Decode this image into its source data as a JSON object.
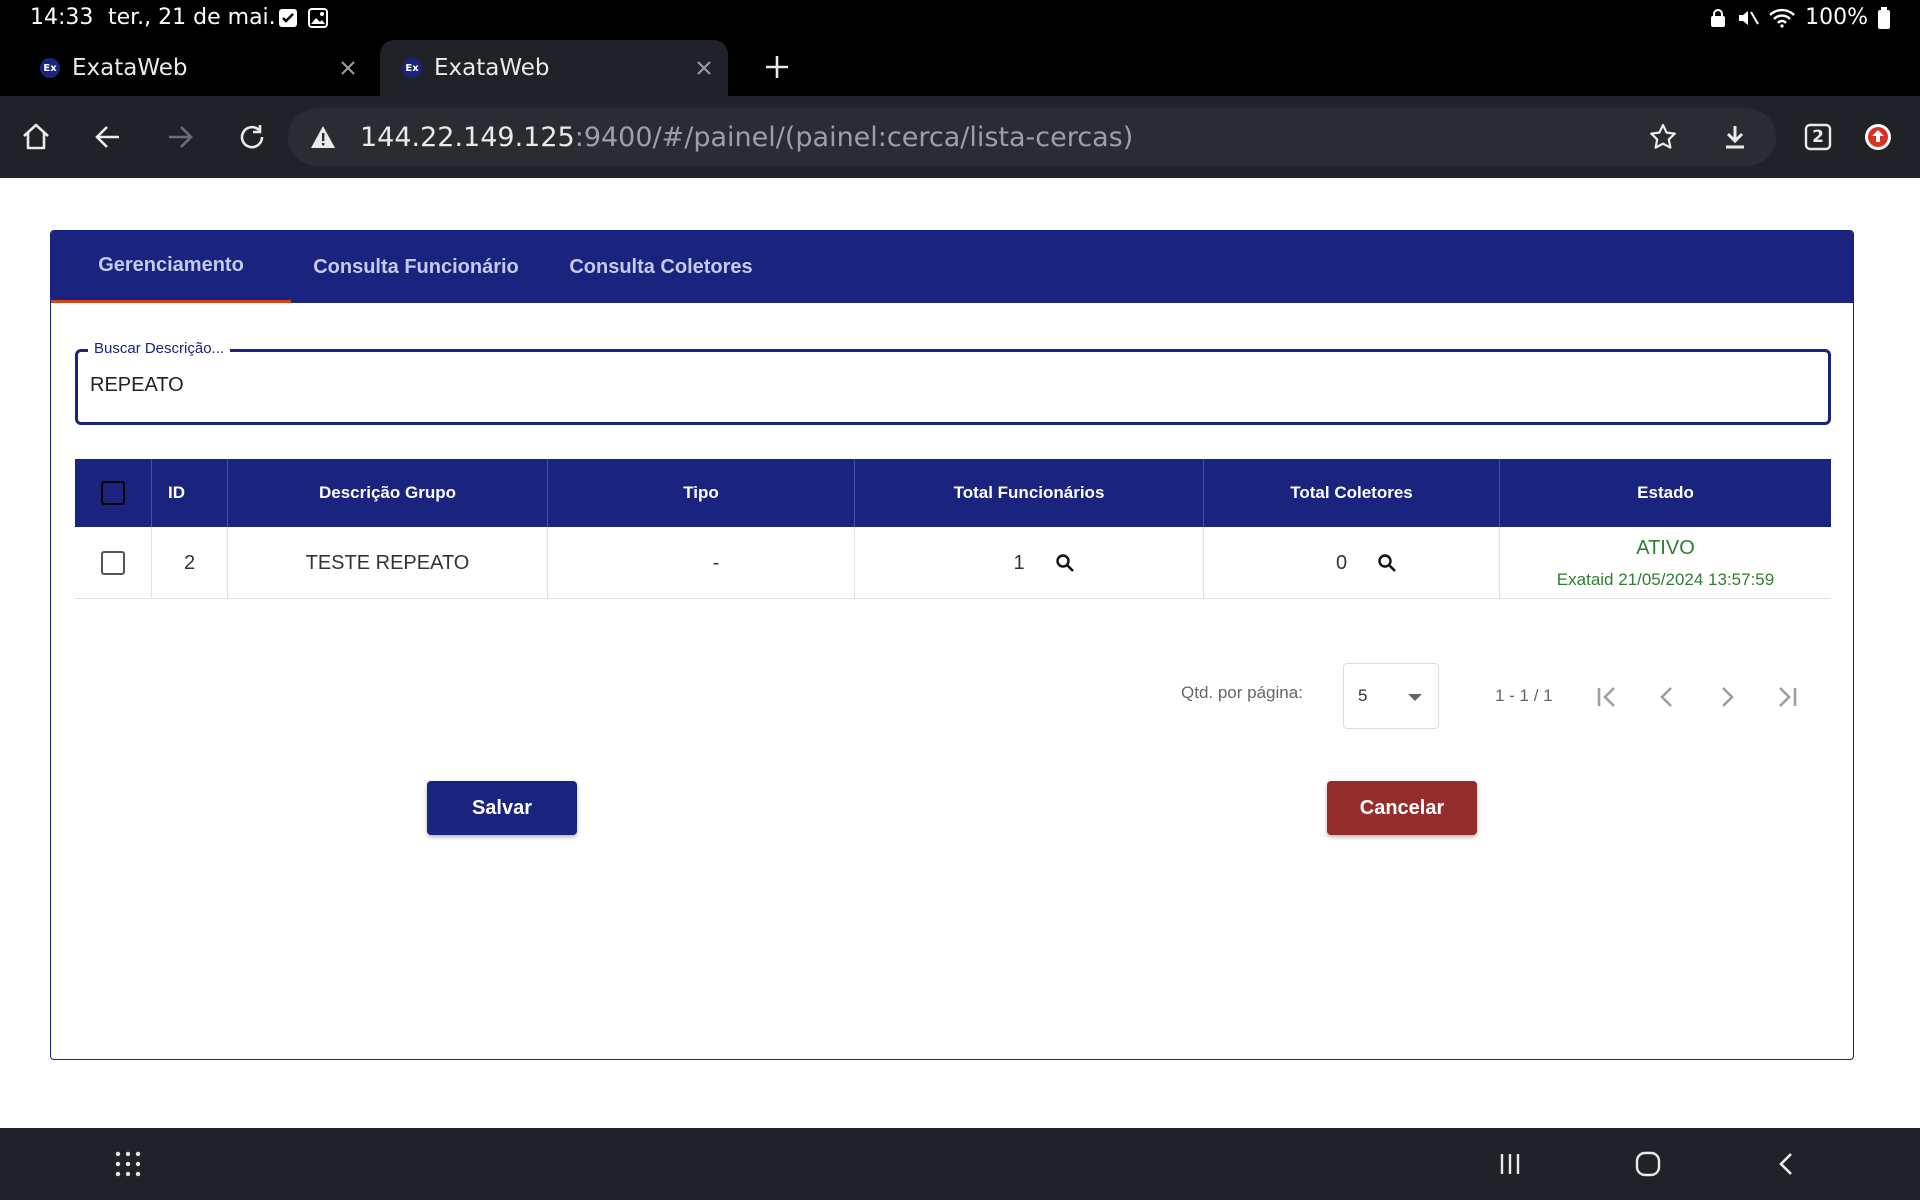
{
  "status_bar": {
    "time": "14:33",
    "date": "ter., 21 de mai.",
    "battery": "100%"
  },
  "browser": {
    "tabs": [
      {
        "title": "ExataWeb",
        "favicon": "Ex"
      },
      {
        "title": "ExataWeb",
        "favicon": "Ex"
      }
    ],
    "url_host": "144.22.149.125",
    "url_rest": ":9400/#/painel/(painel:cerca/lista-cercas)",
    "tab_count": "2"
  },
  "app": {
    "tabs": [
      "Gerenciamento",
      "Consulta Funcionário",
      "Consulta Coletores"
    ],
    "search": {
      "label": "Buscar Descrição...",
      "value": "REPEATO"
    },
    "table": {
      "headers": [
        "ID",
        "Descrição Grupo",
        "Tipo",
        "Total Funcionários",
        "Total Coletores",
        "Estado"
      ],
      "rows": [
        {
          "id": "2",
          "descricao": "TESTE REPEATO",
          "tipo": "-",
          "total_funcionarios": "1",
          "total_coletores": "0",
          "estado": "ATIVO",
          "estado_detalhe": "Exataid 21/05/2024 13:57:59"
        }
      ]
    },
    "paginator": {
      "label": "Qtd. por página:",
      "page_size": "5",
      "range": "1 - 1 / 1"
    },
    "buttons": {
      "save": "Salvar",
      "cancel": "Cancelar"
    }
  },
  "colors": {
    "primary": "#1a237e",
    "danger": "#962d2d",
    "success": "#2e7d32"
  }
}
